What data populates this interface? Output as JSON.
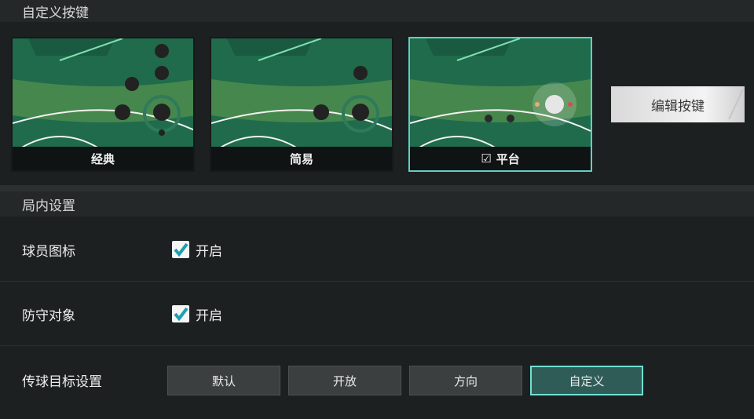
{
  "custom_keys": {
    "title": "自定义按键",
    "layouts": [
      {
        "label": "经典",
        "selected": false
      },
      {
        "label": "简易",
        "selected": false
      },
      {
        "label": "平台",
        "selected": true
      }
    ],
    "edit_button": "编辑按键"
  },
  "ingame": {
    "title": "局内设置",
    "player_icon": {
      "label": "球员图标",
      "option": "开启",
      "checked": true
    },
    "defense_target": {
      "label": "防守对象",
      "option": "开启",
      "checked": true
    },
    "pass_target": {
      "label": "传球目标设置",
      "options": [
        "默认",
        "开放",
        "方向",
        "自定义"
      ],
      "selected": "自定义"
    }
  },
  "colors": {
    "accent": "#5fd0c2",
    "check": "#1e9fb0",
    "field_dark": "#1f6b4c",
    "field_light": "#4a8d52"
  }
}
